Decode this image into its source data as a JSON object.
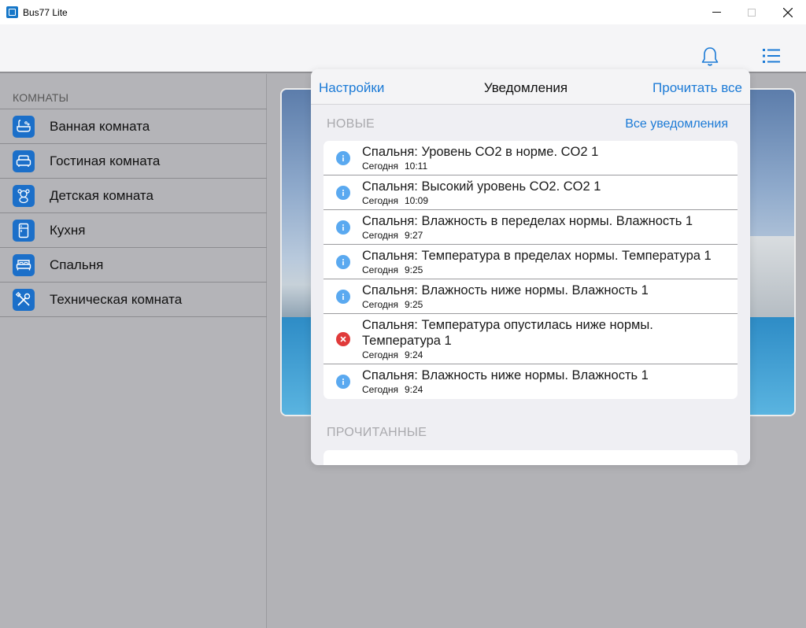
{
  "window": {
    "title": "Bus77 Lite",
    "minimize": "—",
    "maximize": "☐",
    "close": "✕"
  },
  "header": {
    "bell_icon": "bell-icon",
    "menu_icon": "list-menu-icon"
  },
  "sidebar": {
    "title": "КОМНАТЫ",
    "rooms": [
      {
        "label": "Ванная комната",
        "icon": "bathtub-icon"
      },
      {
        "label": "Гостиная комната",
        "icon": "sofa-icon"
      },
      {
        "label": "Детская комната",
        "icon": "teddy-bear-icon"
      },
      {
        "label": "Кухня",
        "icon": "fridge-icon"
      },
      {
        "label": "Спальня",
        "icon": "bed-icon"
      },
      {
        "label": "Техническая комната",
        "icon": "tools-icon"
      }
    ]
  },
  "notifications": {
    "settings_label": "Настройки",
    "title": "Уведомления",
    "read_all_label": "Прочитать все",
    "new_section": "НОВЫЕ",
    "all_label": "Все уведомления",
    "read_section": "ПРОЧИТАННЫЕ",
    "items": [
      {
        "type": "info",
        "text": "Спальня: Уровень CO2 в норме. CO2 1",
        "day": "Сегодня",
        "time": "10:11"
      },
      {
        "type": "info",
        "text": "Спальня: Высокий уровень CO2. CO2 1",
        "day": "Сегодня",
        "time": "10:09"
      },
      {
        "type": "info",
        "text": "Спальня: Влажность в переделах нормы. Влажность 1",
        "day": "Сегодня",
        "time": "9:27"
      },
      {
        "type": "info",
        "text": "Спальня: Температура в пределах нормы. Температура 1",
        "day": "Сегодня",
        "time": "9:25"
      },
      {
        "type": "info",
        "text": "Спальня: Влажность ниже нормы. Влажность 1",
        "day": "Сегодня",
        "time": "9:25"
      },
      {
        "type": "error",
        "text": "Спальня: Температура опустилась ниже нормы. Температура 1",
        "day": "Сегодня",
        "time": "9:24"
      },
      {
        "type": "info",
        "text": "Спальня: Влажность ниже нормы. Влажность 1",
        "day": "Сегодня",
        "time": "9:24"
      }
    ]
  },
  "colors": {
    "accent": "#1b7ad6",
    "info": "#5aa9f0",
    "error": "#e03a3a",
    "room_icon": "#1b6fc9"
  }
}
